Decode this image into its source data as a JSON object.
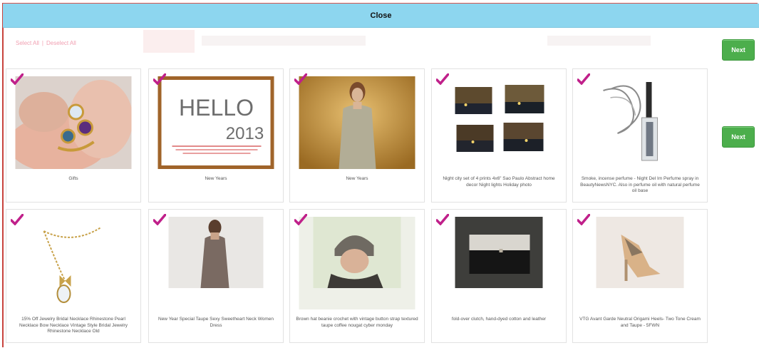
{
  "close_bar": {
    "label": "Close"
  },
  "selection": {
    "select_all": "Select All",
    "separator": "|",
    "deselect_all": "Deselect All"
  },
  "next_buttons": [
    {
      "label": "Next"
    },
    {
      "label": "Next"
    }
  ],
  "colors": {
    "accent": "#8dd6ef",
    "check": "#c0208a",
    "next": "#4cae4c"
  },
  "cards": [
    {
      "caption": "Gifts",
      "image": "rings-photo",
      "checked": true
    },
    {
      "caption": "New Years",
      "image": "hello-2013-card",
      "checked": true
    },
    {
      "caption": "New Years",
      "image": "glitter-dress-photo",
      "checked": true
    },
    {
      "caption": "Night city set of 4 prints 4x6\" Sao Paulo Abstract home decor Night lights Holiday photo",
      "image": "night-city-prints",
      "checked": true
    },
    {
      "caption": "Smoke, incense perfume - Night Del Im Perfume spray in BeautyNewsNYC. Also in perfume oil with natural perfume oil base",
      "image": "perfume-smoke",
      "checked": true
    },
    {
      "caption": "15% Off Jewelry Bridal Necklace Rhinestone Pearl Necklace Bow Necklace Vintage Style Bridal Jewelry Rhinestone Necklace Old",
      "image": "bow-necklace",
      "checked": true
    },
    {
      "caption": "New Year Special Taupe Sexy Sweetheart Neck Women Dress",
      "image": "taupe-dress",
      "checked": true
    },
    {
      "caption": "Brown hat beanie crochet with vintage button strap textured taupe coffee nougat cyber monday",
      "image": "crochet-hat",
      "checked": true
    },
    {
      "caption": "fold-over clutch, hand-dyed cotton and leather",
      "image": "fold-over-clutch",
      "checked": true
    },
    {
      "caption": "VTG Avant Garde Neutral Origami Heels- Two Tone Cream and Taupe - 5FWN",
      "image": "origami-heels",
      "checked": true
    }
  ],
  "hello_card": {
    "line1": "HELLO",
    "line2": "2013"
  }
}
